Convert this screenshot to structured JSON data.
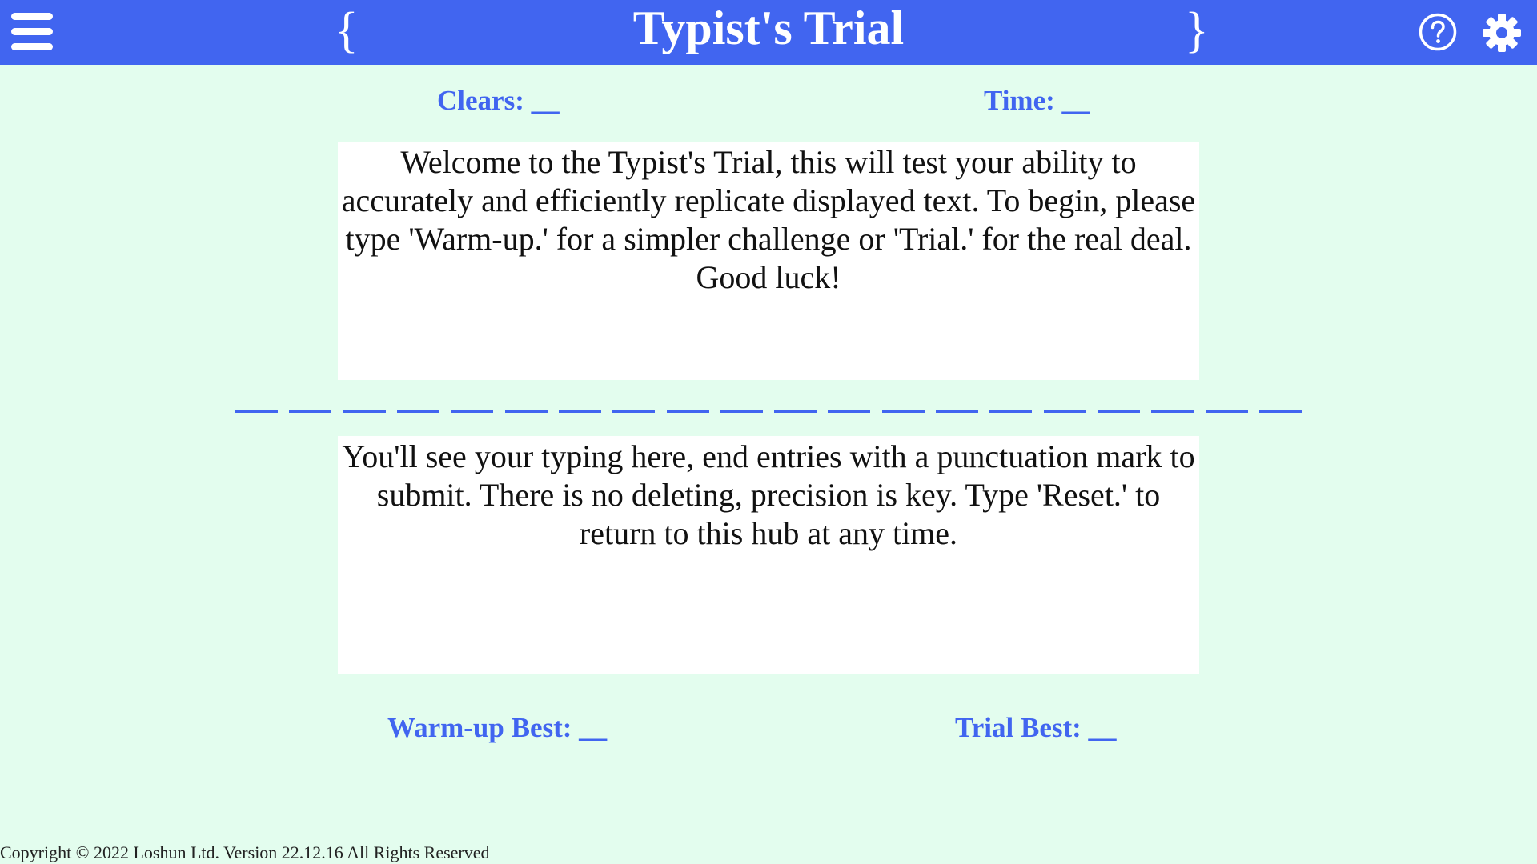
{
  "header": {
    "title": "Typist's Trial",
    "left_brace": "{",
    "right_brace": "}",
    "menu_icon": "hamburger-menu-icon",
    "help_icon": "help-circle-icon",
    "settings_icon": "gear-icon",
    "background_color": "#4165f0"
  },
  "stats": {
    "clears": "Clears: __",
    "time": "Time: __",
    "warmup_best": "Warm-up Best: __",
    "trial_best": "Trial Best: __"
  },
  "prompt_text": "Welcome to the Typist's Trial, this will test your ability to accurately and efficiently replicate displayed text. To begin, please type 'Warm-up.' for a simpler challenge or 'Trial.' for the real deal. Good luck!",
  "typing_text": "You'll see your typing here, end entries with a punctuation mark to submit. There is no deleting, precision is key. Type 'Reset.' to return to this hub at any time.",
  "blank_slots": 20,
  "footer": "Copyright © 2022 Loshun Ltd. Version 22.12.16 All Rights Reserved",
  "colors": {
    "accent": "#4165f0",
    "page_background": "#e3fdee",
    "panel_background": "#ffffff"
  }
}
